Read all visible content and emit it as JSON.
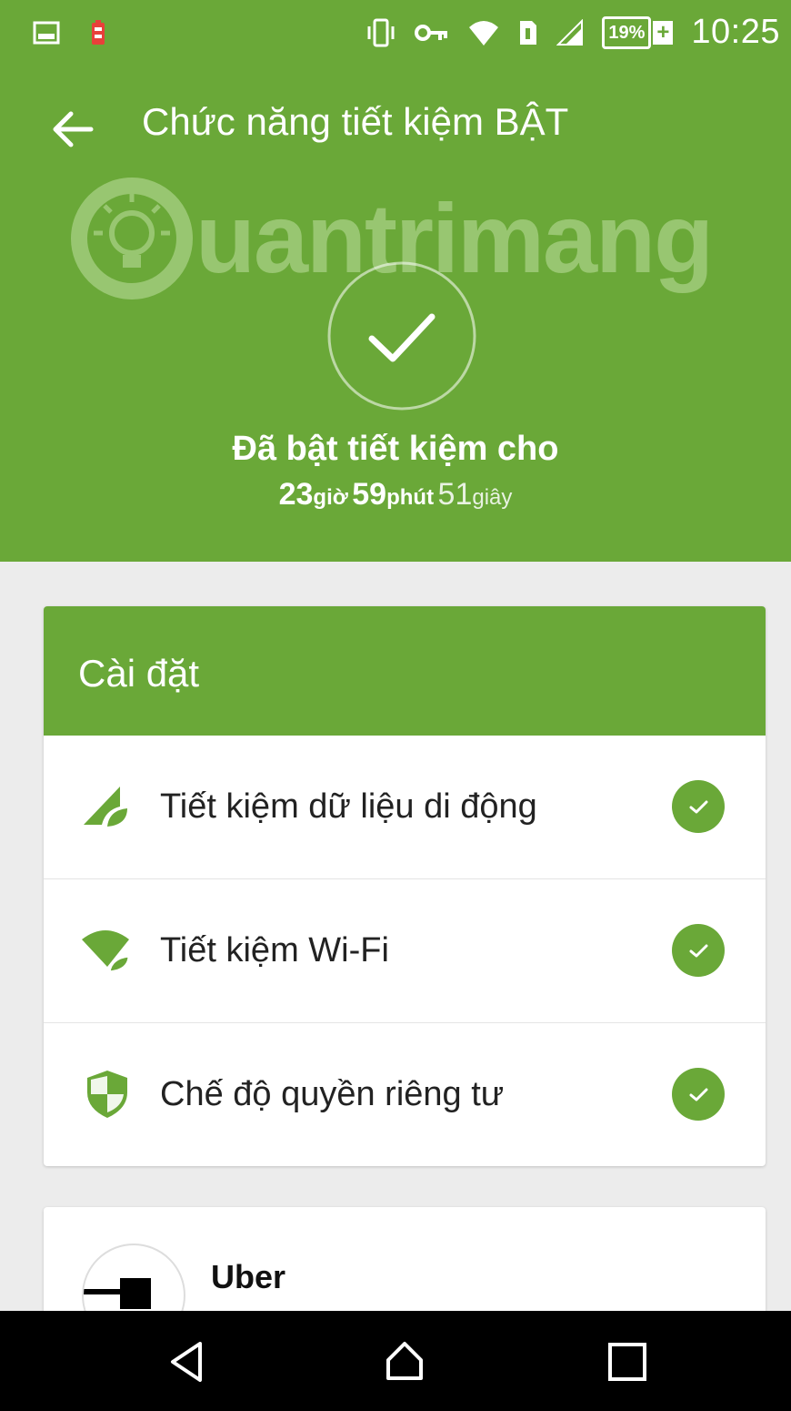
{
  "status_bar": {
    "time": "10:25",
    "battery_percent": "19%",
    "icons": [
      "image-icon",
      "battery-alert-icon",
      "vibrate-icon",
      "vpn-key-icon",
      "wifi-icon",
      "sim-icon",
      "signal-icon",
      "battery-icon"
    ]
  },
  "header": {
    "title": "Chức năng tiết kiệm BẬT",
    "watermark_text": "uantrimang",
    "enabled_label": "Đã bật tiết kiệm cho",
    "timer": {
      "hours": "23",
      "hours_unit": "giờ",
      "minutes": "59",
      "minutes_unit": "phút",
      "seconds": "51",
      "seconds_unit": "giây"
    }
  },
  "settings": {
    "title": "Cài đặt",
    "items": [
      {
        "label": "Tiết kiệm dữ liệu di động",
        "icon": "mobile-data-leaf-icon",
        "enabled": true
      },
      {
        "label": "Tiết kiệm Wi-Fi",
        "icon": "wifi-leaf-icon",
        "enabled": true
      },
      {
        "label": "Chế độ quyền riêng tư",
        "icon": "shield-icon",
        "enabled": true
      }
    ]
  },
  "apps": [
    {
      "name": "Uber",
      "icon": "uber-logo-icon"
    }
  ],
  "navbar": {
    "icons": [
      "back-nav-icon",
      "home-nav-icon",
      "recents-nav-icon"
    ]
  },
  "colors": {
    "primary_green": "#6aa838",
    "background": "#ececec",
    "card": "#ffffff"
  }
}
